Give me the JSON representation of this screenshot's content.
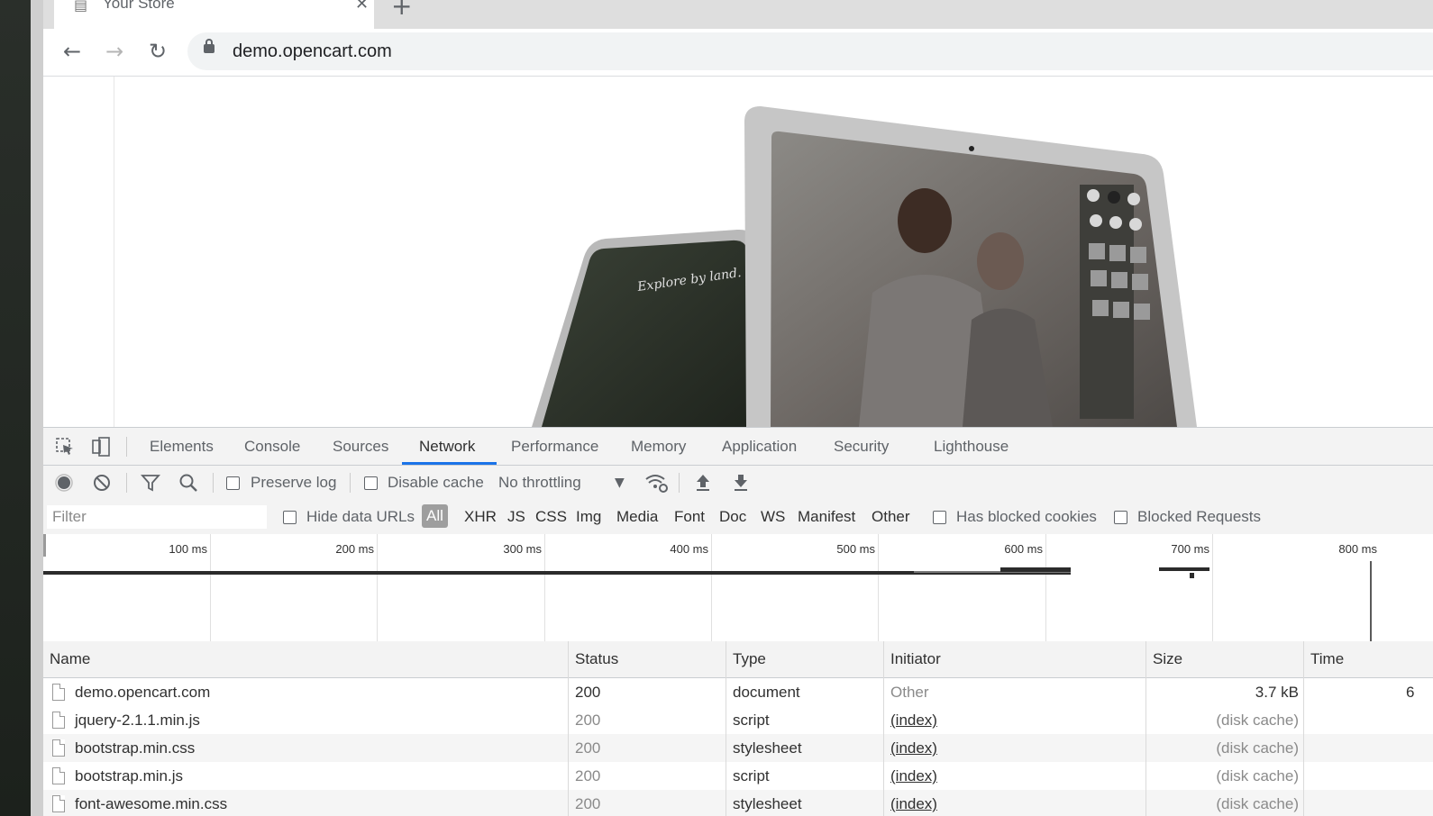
{
  "browser": {
    "tab": {
      "title": "Your Store",
      "close_glyph": "✕"
    },
    "new_tab_glyph": "+",
    "nav": {
      "back_glyph": "←",
      "forward_glyph": "→",
      "reload_glyph": "↻"
    },
    "url": "demo.opencart.com"
  },
  "devtools": {
    "tabs": [
      "Elements",
      "Console",
      "Sources",
      "Network",
      "Performance",
      "Memory",
      "Application",
      "Security",
      "Lighthouse"
    ],
    "active_tab": "Network",
    "network_toolbar": {
      "preserve_log": "Preserve log",
      "disable_cache": "Disable cache",
      "throttling": "No throttling",
      "throttling_arrow": "▼"
    },
    "filter": {
      "placeholder": "Filter",
      "hide_data_urls": "Hide data URLs",
      "types": [
        "All",
        "XHR",
        "JS",
        "CSS",
        "Img",
        "Media",
        "Font",
        "Doc",
        "WS",
        "Manifest",
        "Other"
      ],
      "active_type": "All",
      "has_blocked_cookies": "Has blocked cookies",
      "blocked_requests": "Blocked Requests"
    },
    "overview": {
      "ticks": [
        "100 ms",
        "200 ms",
        "300 ms",
        "400 ms",
        "500 ms",
        "600 ms",
        "700 ms",
        "800 ms"
      ]
    },
    "table": {
      "columns": [
        "Name",
        "Status",
        "Type",
        "Initiator",
        "Size",
        "Time"
      ],
      "rows": [
        {
          "name": "demo.opencart.com",
          "status": "200",
          "type": "document",
          "initiator": "Other",
          "size": "3.7 kB",
          "time": "6"
        },
        {
          "name": "jquery-2.1.1.min.js",
          "status": "200",
          "type": "script",
          "initiator": "(index)",
          "size": "(disk cache)",
          "time": ""
        },
        {
          "name": "bootstrap.min.css",
          "status": "200",
          "type": "stylesheet",
          "initiator": "(index)",
          "size": "(disk cache)",
          "time": ""
        },
        {
          "name": "bootstrap.min.js",
          "status": "200",
          "type": "script",
          "initiator": "(index)",
          "size": "(disk cache)",
          "time": ""
        },
        {
          "name": "font-awesome.min.css",
          "status": "200",
          "type": "stylesheet",
          "initiator": "(index)",
          "size": "(disk cache)",
          "time": ""
        }
      ]
    }
  }
}
